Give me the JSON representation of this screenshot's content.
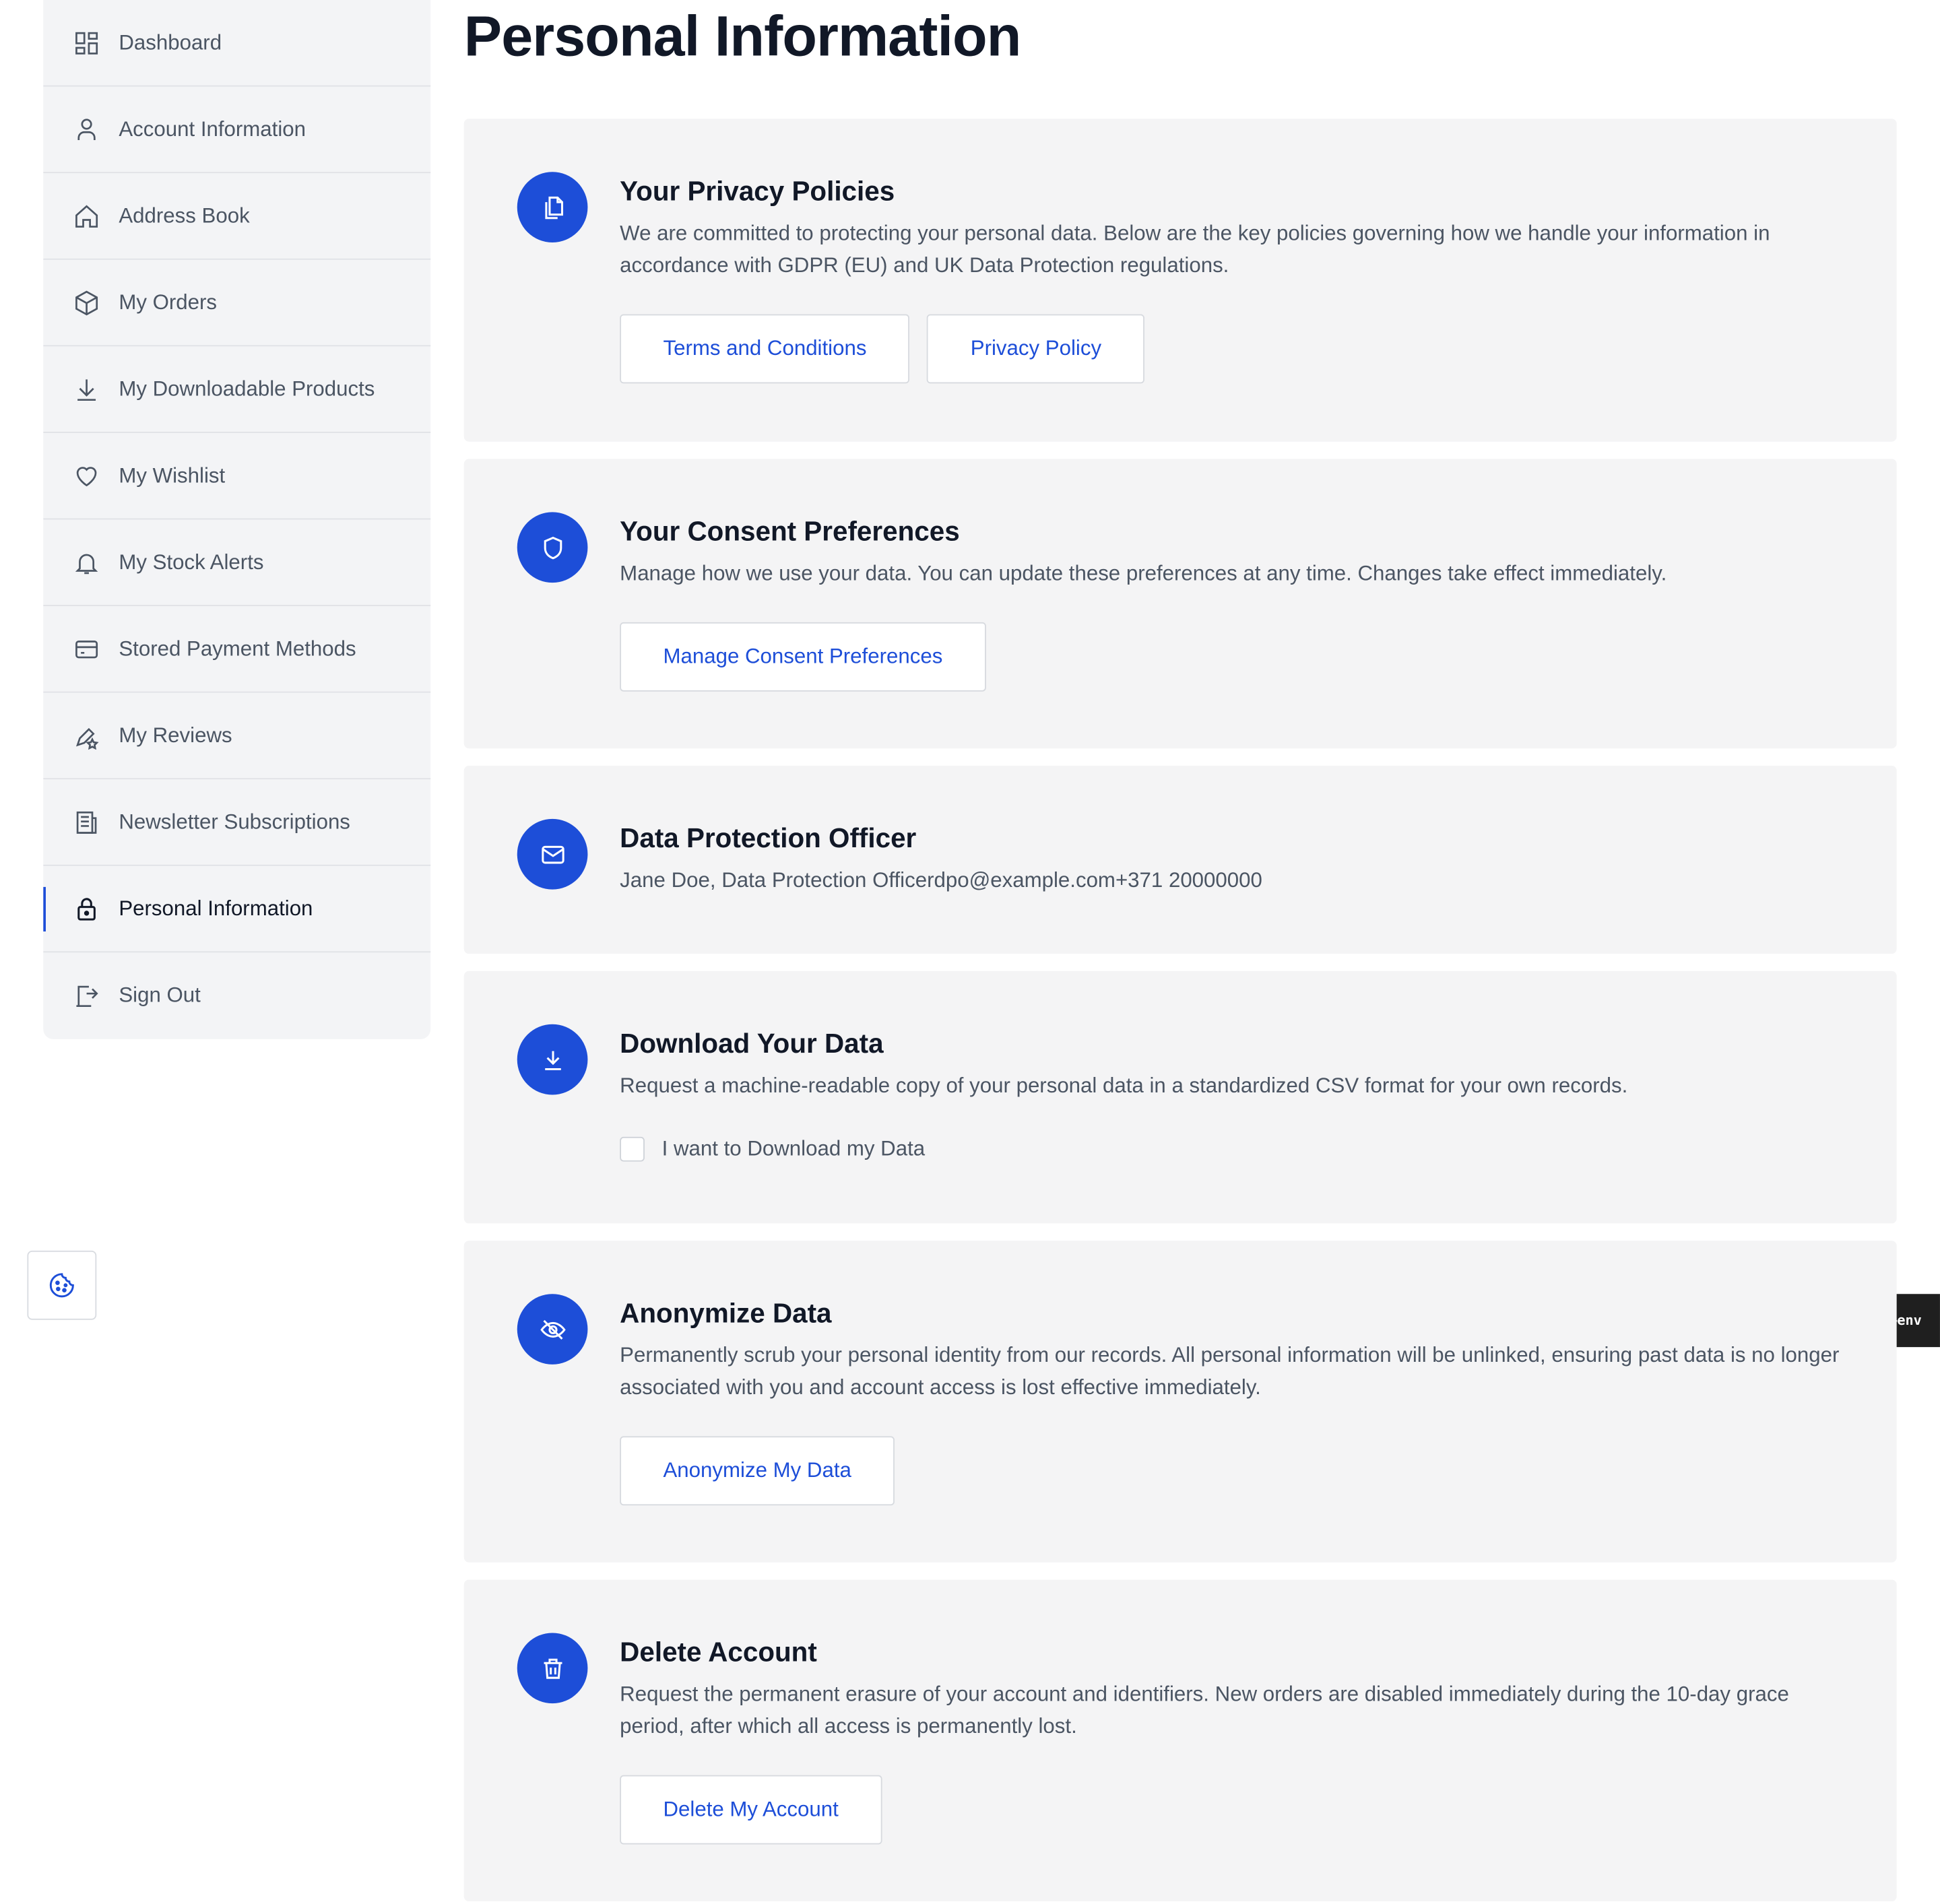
{
  "sidebar": {
    "items": [
      {
        "label": "Dashboard",
        "icon": "dashboard-icon"
      },
      {
        "label": "Account Information",
        "icon": "user-icon"
      },
      {
        "label": "Address Book",
        "icon": "home-icon"
      },
      {
        "label": "My Orders",
        "icon": "box-icon"
      },
      {
        "label": "My Downloadable Products",
        "icon": "download-icon"
      },
      {
        "label": "My Wishlist",
        "icon": "heart-icon"
      },
      {
        "label": "My Stock Alerts",
        "icon": "bell-icon"
      },
      {
        "label": "Stored Payment Methods",
        "icon": "credit-card-icon"
      },
      {
        "label": "My Reviews",
        "icon": "review-star-icon"
      },
      {
        "label": "Newsletter Subscriptions",
        "icon": "newsletter-icon"
      },
      {
        "label": "Personal Information",
        "icon": "lock-icon",
        "active": true
      },
      {
        "label": "Sign Out",
        "icon": "sign-out-icon"
      }
    ]
  },
  "page": {
    "title": "Personal Information"
  },
  "sections": {
    "privacy": {
      "icon": "documents-icon",
      "title": "Your Privacy Policies",
      "description": "We are committed to protecting your personal data. Below are the key policies governing how we handle your information in accordance with GDPR (EU) and UK Data Protection regulations.",
      "terms_label": "Terms and Conditions",
      "privacy_label": "Privacy Policy"
    },
    "consent": {
      "icon": "shield-icon",
      "title": "Your Consent Preferences",
      "description": "Manage how we use your data. You can update these preferences at any time. Changes take effect immediately.",
      "button_label": "Manage Consent Preferences"
    },
    "dpo": {
      "icon": "mail-icon",
      "title": "Data Protection Officer",
      "description": "Jane Doe, Data Protection Officerdpo@example.com+371 20000000"
    },
    "download": {
      "icon": "download-icon",
      "title": "Download Your Data",
      "description": "Request a machine-readable copy of your personal data in a standardized CSV format for your own records.",
      "checkbox_label": "I want to Download my Data",
      "checked": false
    },
    "anonymize": {
      "icon": "eye-off-icon",
      "title": "Anonymize Data",
      "description": "Permanently scrub your personal identity from our records. All personal information will be unlinked, ensuring past data is no longer associated with you and account access is lost effective immediately.",
      "button_label": "Anonymize My Data"
    },
    "delete": {
      "icon": "trash-icon",
      "title": "Delete Account",
      "description": "Request the permanent erasure of your account and identifiers. New orders are disabled immediately during the 10-day grace period, after which all access is permanently lost.",
      "button_label": "Delete My Account"
    }
  },
  "cookie_button": {
    "icon": "cookie-icon"
  },
  "env_tag": {
    "label": "▸ mage—env"
  },
  "colors": {
    "accent": "#1d4ed8",
    "card_bg": "#f4f4f5",
    "sidebar_bg": "#f3f4f6",
    "heading": "#111827",
    "body_text": "#4b5563"
  }
}
